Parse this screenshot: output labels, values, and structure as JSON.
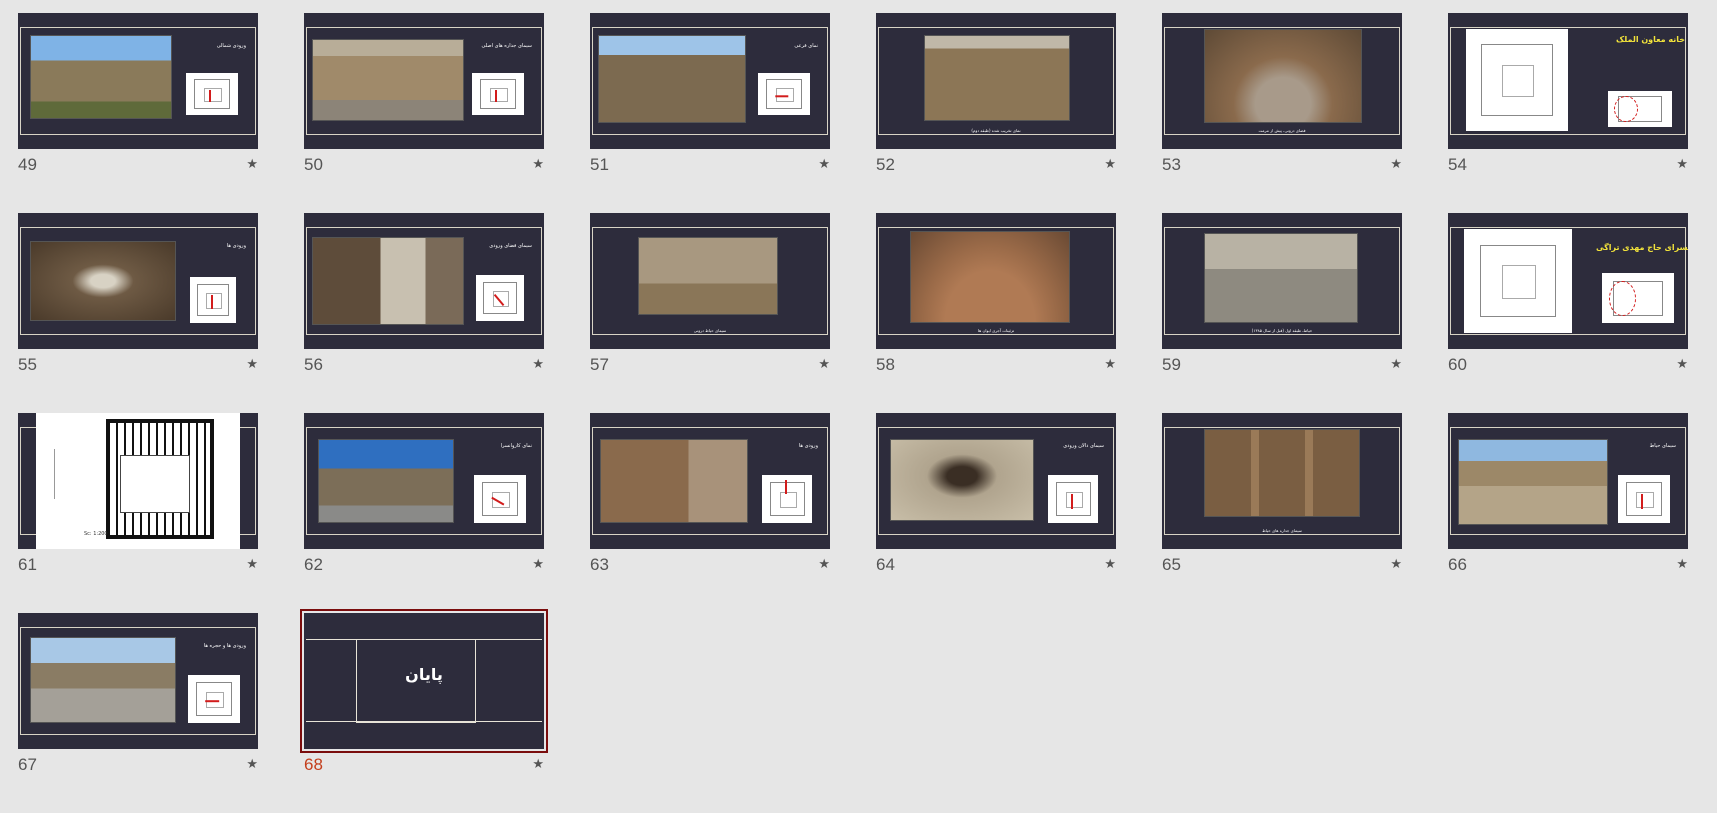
{
  "slides": [
    {
      "number": "49",
      "title": "ورودی شمالی",
      "caption": "",
      "star": "★",
      "photo_color": "#8a7a5a",
      "sky": "#7fb3e6"
    },
    {
      "number": "50",
      "title": "سیمای جداره های اصلی",
      "caption": "",
      "star": "★",
      "photo_color": "#a08a6a",
      "sky": ""
    },
    {
      "number": "51",
      "title": "نمای فرعی",
      "caption": "",
      "star": "★",
      "photo_color": "#7c6a50",
      "sky": "#9ec4e8"
    },
    {
      "number": "52",
      "title": "",
      "caption": "نمای تخریب شده (طبقه دوم)",
      "star": "★",
      "photo_color": "#8c7656",
      "sky": ""
    },
    {
      "number": "53",
      "title": "",
      "caption": "فضای درونی، پیش از مرمت",
      "star": "★",
      "photo_color": "#8a6a4c",
      "sky": ""
    },
    {
      "number": "54",
      "title": "تجارت خانه معاون الملک",
      "caption": "",
      "star": "★",
      "photo_color": "#ffffff",
      "sky": ""
    },
    {
      "number": "55",
      "title": "ورودی ها",
      "caption": "",
      "star": "★",
      "photo_color": "#6e5a44",
      "sky": ""
    },
    {
      "number": "56",
      "title": "سیمای فضای ورودی",
      "caption": "",
      "star": "★",
      "photo_color": "#5e4c3a",
      "sky": ""
    },
    {
      "number": "57",
      "title": "",
      "caption": "سیمای حیاط درونی",
      "star": "★",
      "photo_color": "#8a7658",
      "sky": ""
    },
    {
      "number": "58",
      "title": "",
      "caption": "تزئینات آجری ایوان ها",
      "star": "★",
      "photo_color": "#9a6a48",
      "sky": ""
    },
    {
      "number": "59",
      "title": "",
      "caption": "حیاط، طبقه اول (قبل از سال ۱۳۸۵)",
      "star": "★",
      "photo_color": "#8e8a80",
      "sky": ""
    },
    {
      "number": "60",
      "title": "کاروانسرای حاج مهدی تراگی",
      "caption": "",
      "star": "★",
      "photo_color": "#ffffff",
      "sky": ""
    },
    {
      "number": "61",
      "title": "",
      "caption": "",
      "star": "★",
      "scale": "Sc: 1:200",
      "photo_color": "#ffffff",
      "sky": ""
    },
    {
      "number": "62",
      "title": "نمای کاروانسرا",
      "caption": "",
      "star": "★",
      "photo_color": "#7c6e58",
      "sky": "#2f6fc0"
    },
    {
      "number": "63",
      "title": "ورودی ها",
      "caption": "",
      "star": "★",
      "photo_color": "#8a6a4c",
      "sky": ""
    },
    {
      "number": "64",
      "title": "سیمای دالان ورودی",
      "caption": "",
      "star": "★",
      "photo_color": "#b0a48e",
      "sky": ""
    },
    {
      "number": "65",
      "title": "",
      "caption": "سیمای جداره های حیاط",
      "star": "★",
      "photo_color": "#7a5e42",
      "sky": ""
    },
    {
      "number": "66",
      "title": "سیمای حیاط",
      "caption": "",
      "star": "★",
      "photo_color": "#9c8868",
      "sky": "#8fb8e0"
    },
    {
      "number": "67",
      "title": "ورودی ها و حجره ها",
      "caption": "",
      "star": "★",
      "photo_color": "#8a7c64",
      "sky": "#a8c8e6"
    },
    {
      "number": "68",
      "title": "پایان",
      "caption": "",
      "star": "★",
      "photo_color": "",
      "sky": ""
    }
  ]
}
